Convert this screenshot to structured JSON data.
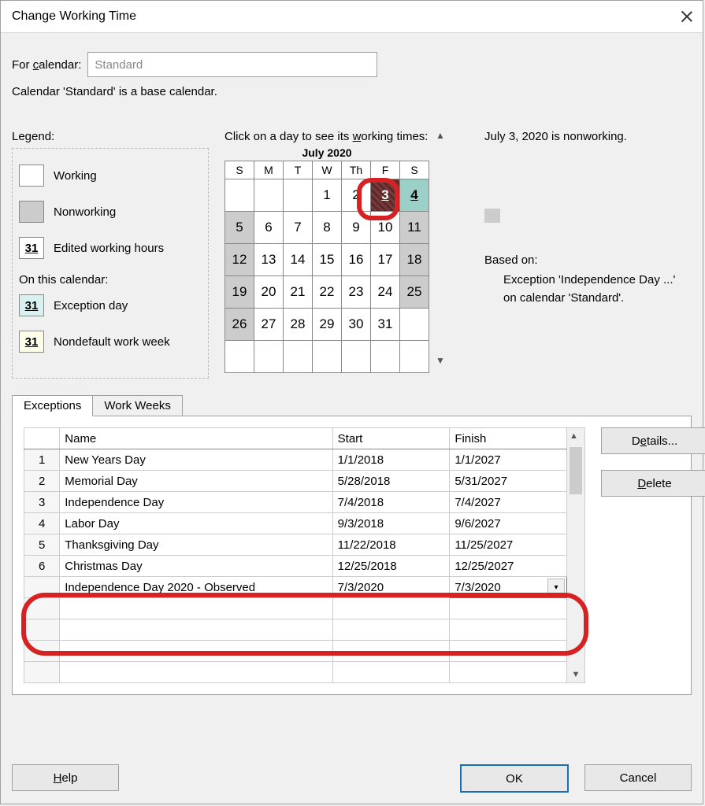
{
  "window": {
    "title": "Change Working Time",
    "for_calendar_label": "For calendar:",
    "for_calendar_underline": "c",
    "calendar_value": "Standard",
    "base_note": "Calendar 'Standard' is a base calendar."
  },
  "legend": {
    "label": "Legend:",
    "items": [
      {
        "swatch": "white",
        "text": "Working",
        "num": ""
      },
      {
        "swatch": "gray",
        "text": "Nonworking",
        "num": ""
      },
      {
        "swatch": "edit",
        "text": "Edited working hours",
        "num": "31"
      }
    ],
    "sublabel": "On this calendar:",
    "items2": [
      {
        "swatch": "excep",
        "text": "Exception day",
        "num": "31"
      },
      {
        "swatch": "nondef",
        "text": "Nondefault work week",
        "num": "31"
      }
    ]
  },
  "calendar": {
    "instr_pre": "Click on a day to see its ",
    "instr_u": "w",
    "instr_post": "orking times:",
    "month": "July 2020",
    "dow": [
      "S",
      "M",
      "T",
      "W",
      "Th",
      "F",
      "S"
    ],
    "weeks": [
      [
        {
          "n": "",
          "c": "empty"
        },
        {
          "n": "",
          "c": "empty"
        },
        {
          "n": "",
          "c": "empty"
        },
        {
          "n": "1",
          "c": ""
        },
        {
          "n": "2",
          "c": ""
        },
        {
          "n": "3",
          "c": "day3"
        },
        {
          "n": "4",
          "c": "weekend day4"
        }
      ],
      [
        {
          "n": "5",
          "c": "weekend"
        },
        {
          "n": "6",
          "c": ""
        },
        {
          "n": "7",
          "c": ""
        },
        {
          "n": "8",
          "c": ""
        },
        {
          "n": "9",
          "c": ""
        },
        {
          "n": "10",
          "c": ""
        },
        {
          "n": "11",
          "c": "weekend"
        }
      ],
      [
        {
          "n": "12",
          "c": "weekend"
        },
        {
          "n": "13",
          "c": ""
        },
        {
          "n": "14",
          "c": ""
        },
        {
          "n": "15",
          "c": ""
        },
        {
          "n": "16",
          "c": ""
        },
        {
          "n": "17",
          "c": ""
        },
        {
          "n": "18",
          "c": "weekend"
        }
      ],
      [
        {
          "n": "19",
          "c": "weekend"
        },
        {
          "n": "20",
          "c": ""
        },
        {
          "n": "21",
          "c": ""
        },
        {
          "n": "22",
          "c": ""
        },
        {
          "n": "23",
          "c": ""
        },
        {
          "n": "24",
          "c": ""
        },
        {
          "n": "25",
          "c": "weekend"
        }
      ],
      [
        {
          "n": "26",
          "c": "weekend"
        },
        {
          "n": "27",
          "c": ""
        },
        {
          "n": "28",
          "c": ""
        },
        {
          "n": "29",
          "c": ""
        },
        {
          "n": "30",
          "c": ""
        },
        {
          "n": "31",
          "c": ""
        },
        {
          "n": "",
          "c": "empty"
        }
      ],
      [
        {
          "n": "",
          "c": "empty"
        },
        {
          "n": "",
          "c": "empty"
        },
        {
          "n": "",
          "c": "empty"
        },
        {
          "n": "",
          "c": "empty"
        },
        {
          "n": "",
          "c": "empty"
        },
        {
          "n": "",
          "c": "empty"
        },
        {
          "n": "",
          "c": "empty"
        }
      ]
    ]
  },
  "info": {
    "status": "July 3, 2020 is nonworking.",
    "based_label": "Based on:",
    "based_text": "Exception 'Independence Day ...' on calendar 'Standard'."
  },
  "tabs": {
    "exceptions": "Exceptions",
    "workweeks": "Work Weeks"
  },
  "table": {
    "headers": {
      "name": "Name",
      "start": "Start",
      "finish": "Finish"
    },
    "rows": [
      {
        "n": "1",
        "name": "New Years Day",
        "start": "1/1/2018",
        "finish": "1/1/2027"
      },
      {
        "n": "2",
        "name": "Memorial Day",
        "start": "5/28/2018",
        "finish": "5/31/2027"
      },
      {
        "n": "3",
        "name": "Independence Day",
        "start": "7/4/2018",
        "finish": "7/4/2027"
      },
      {
        "n": "4",
        "name": "Labor Day",
        "start": "9/3/2018",
        "finish": "9/6/2027"
      },
      {
        "n": "5",
        "name": "Thanksgiving Day",
        "start": "11/22/2018",
        "finish": "11/25/2027"
      },
      {
        "n": "6",
        "name": "Christmas Day",
        "start": "12/25/2018",
        "finish": "12/25/2027"
      },
      {
        "n": "",
        "name": "Independence Day 2020 - Observed",
        "start": "7/3/2020",
        "finish": "7/3/2020"
      }
    ],
    "empty_rows": 4
  },
  "buttons": {
    "details": "Details...",
    "details_u": "e",
    "delete": "Delete",
    "delete_u": "D",
    "help": "Help",
    "help_u": "H",
    "ok": "OK",
    "cancel": "Cancel"
  }
}
